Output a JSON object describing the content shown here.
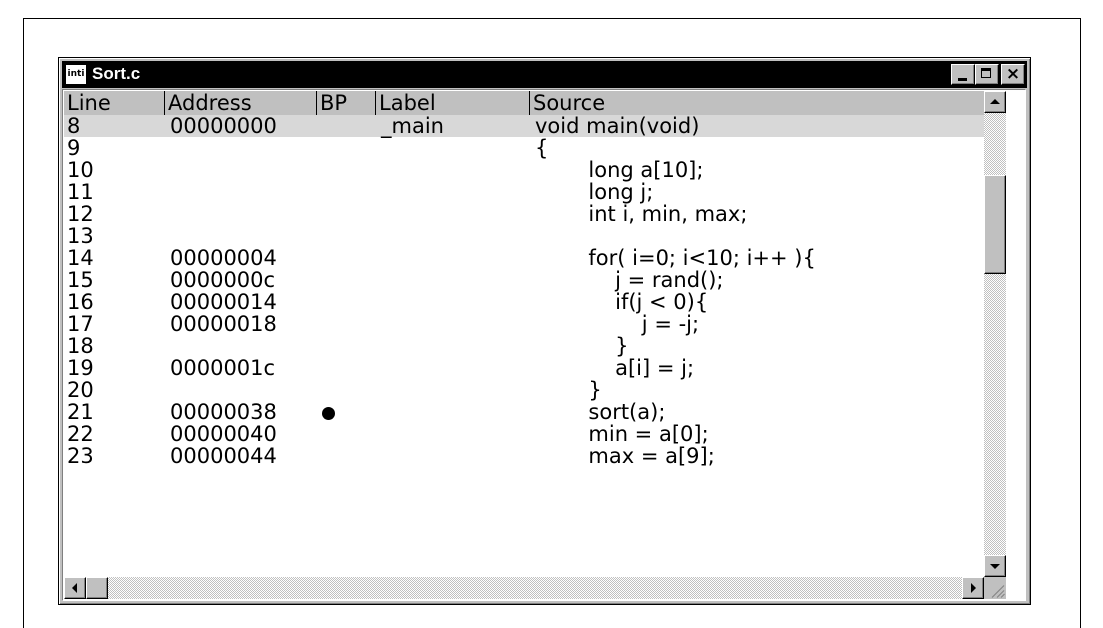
{
  "window": {
    "title": "Sort.c",
    "app_icon_text": "inti",
    "close_glyph": "×"
  },
  "columns": [
    "Line",
    "Address",
    "BP",
    "Label",
    "Source"
  ],
  "rows": [
    {
      "line": "8",
      "address": "00000000",
      "bp": false,
      "label": "_main",
      "source": "void main(void)",
      "current": true
    },
    {
      "line": "9",
      "address": "",
      "bp": false,
      "label": "",
      "source": "{"
    },
    {
      "line": "10",
      "address": "",
      "bp": false,
      "label": "",
      "source": "        long a[10];"
    },
    {
      "line": "11",
      "address": "",
      "bp": false,
      "label": "",
      "source": "        long j;"
    },
    {
      "line": "12",
      "address": "",
      "bp": false,
      "label": "",
      "source": "        int i, min, max;"
    },
    {
      "line": "13",
      "address": "",
      "bp": false,
      "label": "",
      "source": ""
    },
    {
      "line": "14",
      "address": "00000004",
      "bp": false,
      "label": "",
      "source": "        for( i=0; i<10; i++ ){"
    },
    {
      "line": "15",
      "address": "0000000c",
      "bp": false,
      "label": "",
      "source": "            j = rand();"
    },
    {
      "line": "16",
      "address": "00000014",
      "bp": false,
      "label": "",
      "source": "            if(j < 0){"
    },
    {
      "line": "17",
      "address": "00000018",
      "bp": false,
      "label": "",
      "source": "                j = -j;"
    },
    {
      "line": "18",
      "address": "",
      "bp": false,
      "label": "",
      "source": "            }"
    },
    {
      "line": "19",
      "address": "0000001c",
      "bp": false,
      "label": "",
      "source": "            a[i] = j;"
    },
    {
      "line": "20",
      "address": "",
      "bp": false,
      "label": "",
      "source": "        }"
    },
    {
      "line": "21",
      "address": "00000038",
      "bp": true,
      "label": "",
      "source": "        sort(a);"
    },
    {
      "line": "22",
      "address": "00000040",
      "bp": false,
      "label": "",
      "source": "        min = a[0];"
    },
    {
      "line": "23",
      "address": "00000044",
      "bp": false,
      "label": "",
      "source": "        max = a[9];"
    }
  ]
}
